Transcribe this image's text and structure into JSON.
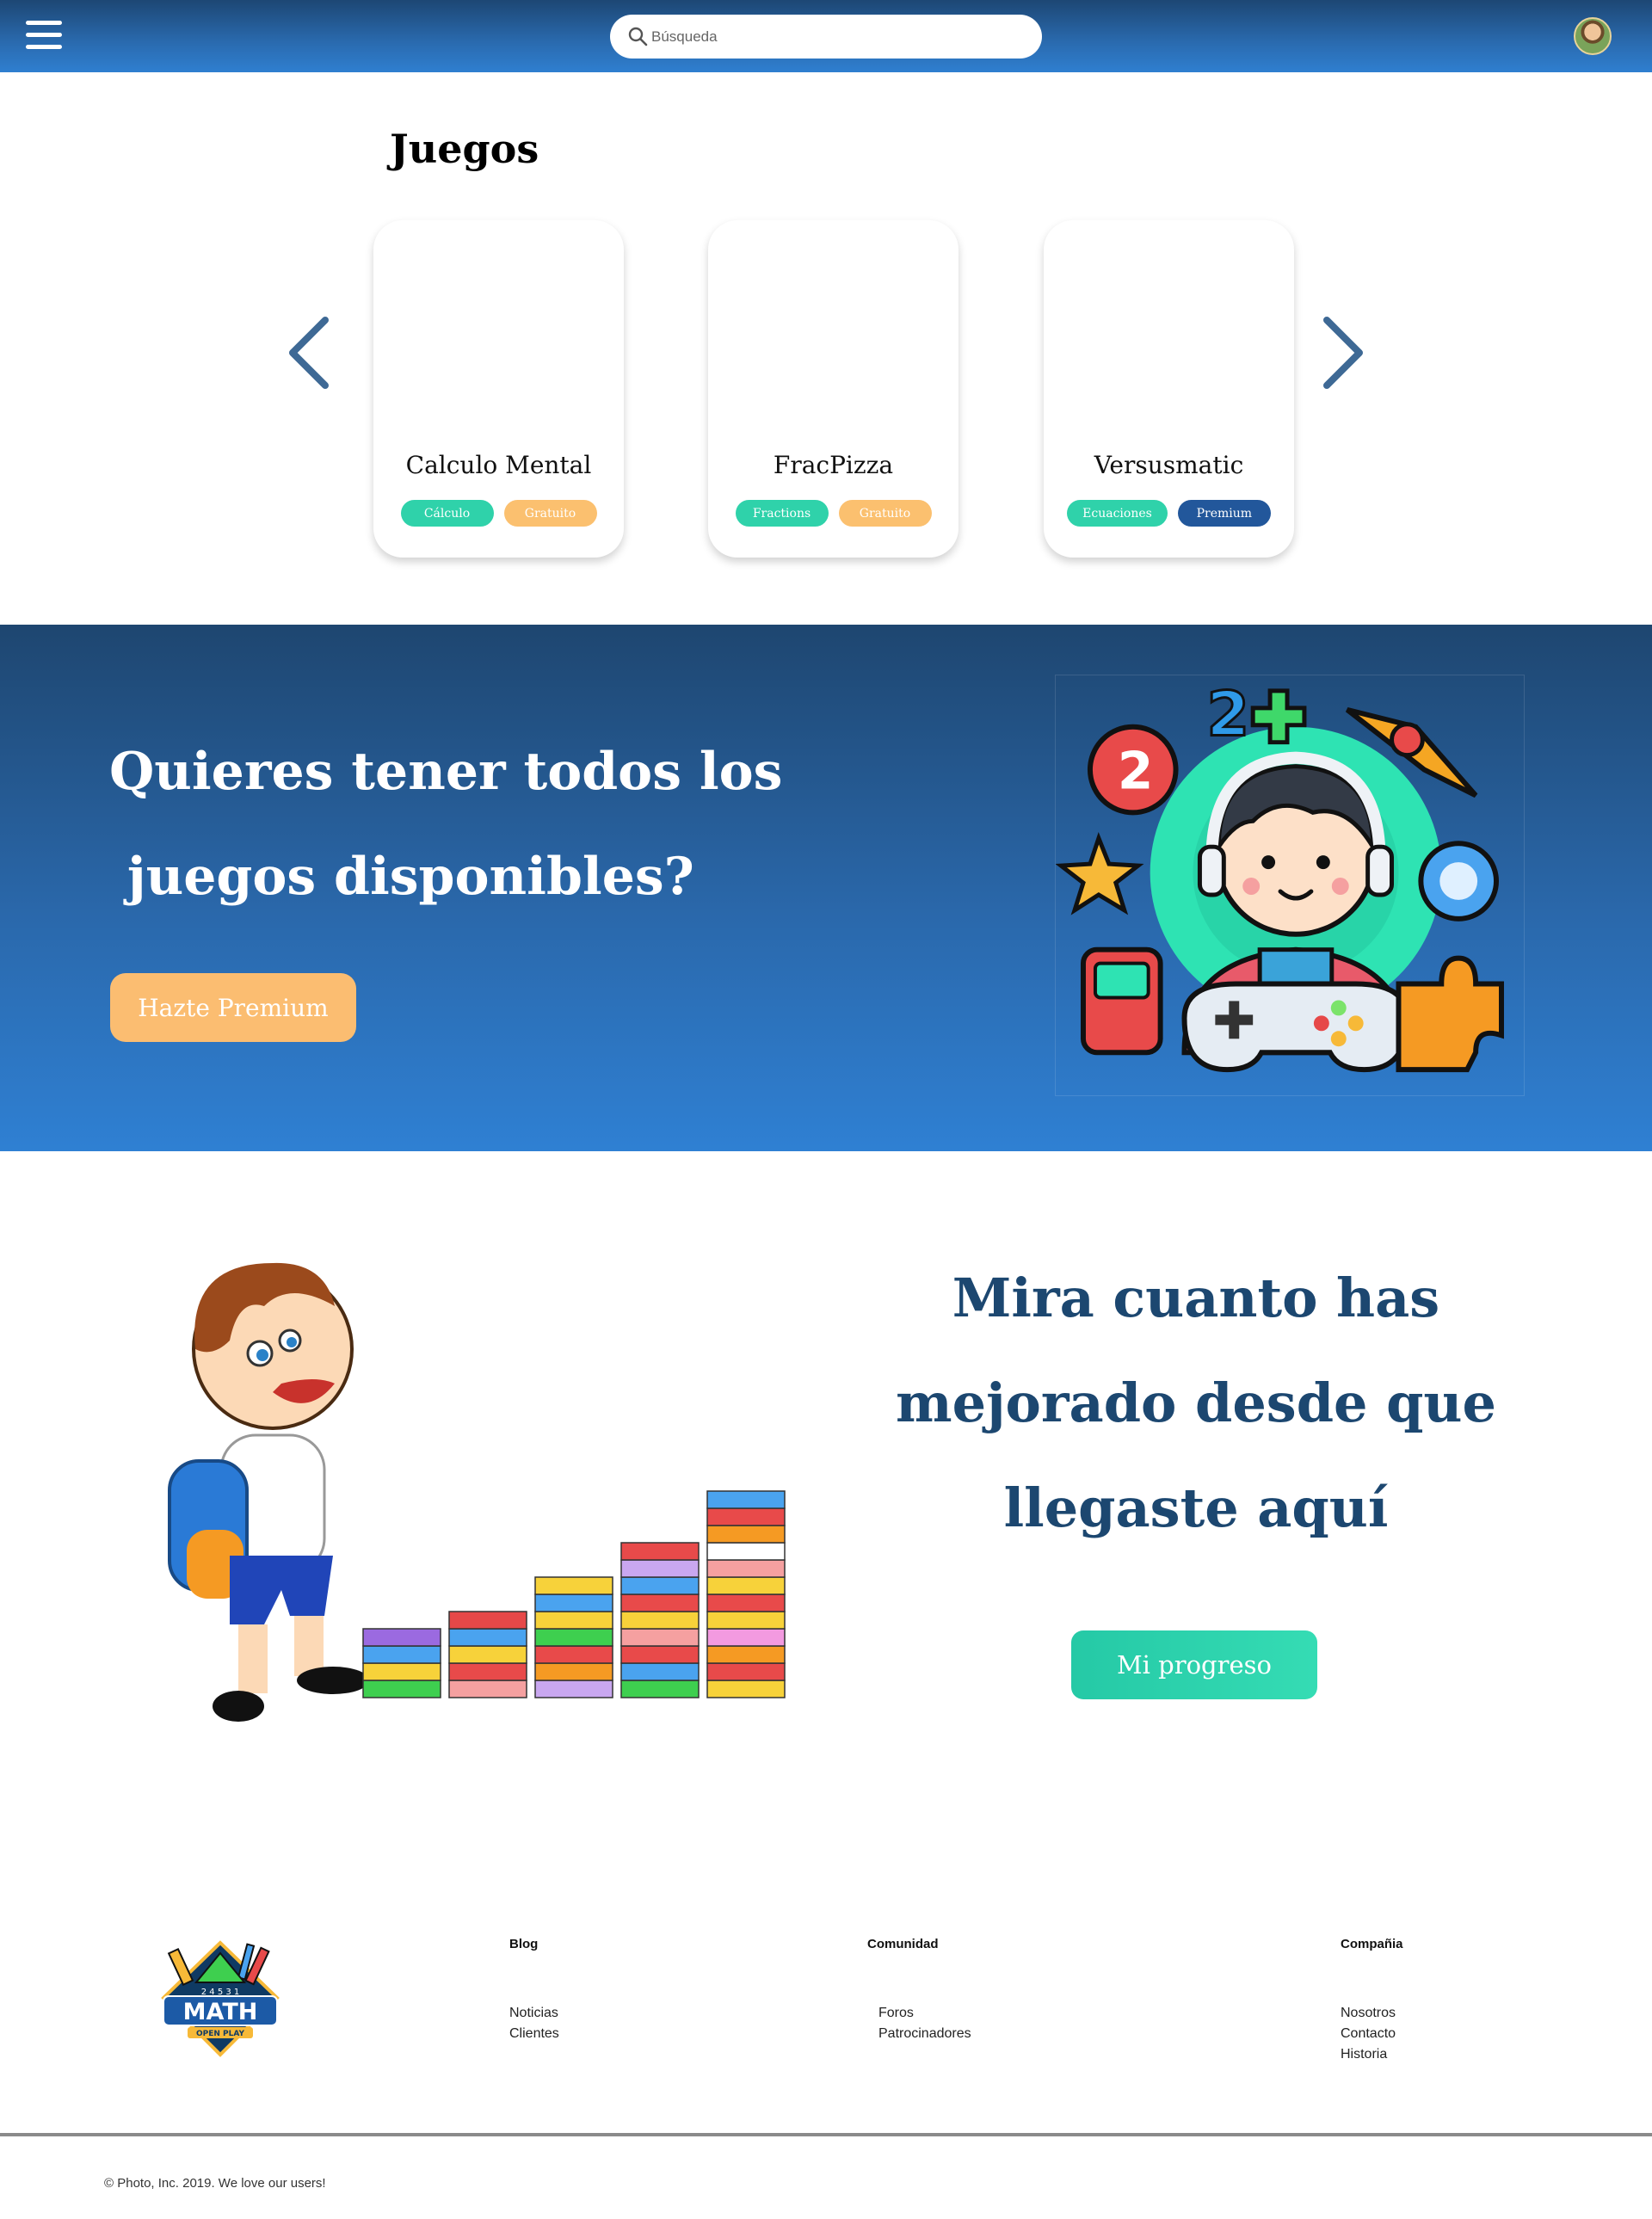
{
  "header": {
    "search_placeholder": "Búsqueda"
  },
  "games": {
    "title": "Juegos",
    "cards": [
      {
        "name": "Calculo Mental",
        "tags": [
          "Cálculo",
          "Gratuito"
        ]
      },
      {
        "name": "FracPizza",
        "tags": [
          "Fractions",
          "Gratuito"
        ]
      },
      {
        "name": "Versusmatic",
        "tags": [
          "Ecuaciones",
          "Premium"
        ]
      }
    ]
  },
  "premium": {
    "title_line1": "Quieres tener todos los",
    "title_line2": " juegos disponibles?",
    "button": "Hazte Premium"
  },
  "progress": {
    "title_line1": "Mira cuanto has",
    "title_line2": "mejorado desde que",
    "title_line3": "llegaste aquí",
    "button": "Mi progreso"
  },
  "footer": {
    "logo_text": "MATH",
    "logo_subtext": "OPEN PLAY",
    "logo_numbers": "2 4 5 3 1",
    "columns": [
      {
        "heading": "Blog",
        "links": [
          "Noticias",
          "Clientes"
        ]
      },
      {
        "heading": "Comunidad",
        "links": [
          "Foros",
          "Patrocinadores"
        ]
      },
      {
        "heading": "Compañia",
        "links": [
          "Nosotros",
          "Contacto",
          "Historia"
        ]
      }
    ],
    "copyright": "© Photo, Inc. 2019. We love our users!"
  },
  "colors": {
    "header_blue": "#1d4774",
    "accent_teal": "#2fd2aa",
    "accent_orange": "#fbc06f",
    "premium_blue": "#22579b",
    "heading_navy": "#1c4770"
  }
}
